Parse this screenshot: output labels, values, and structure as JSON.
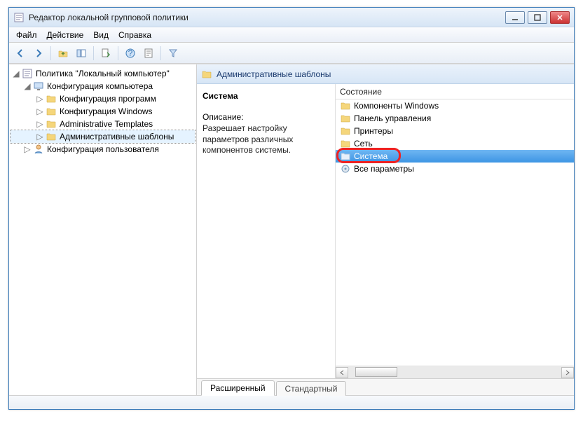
{
  "window": {
    "title": "Редактор локальной групповой политики"
  },
  "menu": {
    "file": "Файл",
    "action": "Действие",
    "view": "Вид",
    "help": "Справка"
  },
  "tree": {
    "root": "Политика \"Локальный компьютер\"",
    "compConfig": "Конфигурация компьютера",
    "progConfig": "Конфигурация программ",
    "winConfig": "Конфигурация Windows",
    "adminTmplEn": "Administrative Templates",
    "adminTmplRu": "Административные шаблоны",
    "userConfig": "Конфигурация пользователя"
  },
  "crumb": "Административные шаблоны",
  "info": {
    "heading": "Система",
    "descLabel": "Описание:",
    "desc": "Разрешает настройку параметров различных компонентов системы."
  },
  "listHeader": "Состояние",
  "items": {
    "winComponents": "Компоненты Windows",
    "controlPanel": "Панель управления",
    "printers": "Принтеры",
    "network": "Сеть",
    "system": "Система",
    "allSettings": "Все параметры"
  },
  "tabs": {
    "extended": "Расширенный",
    "standard": "Стандартный"
  }
}
